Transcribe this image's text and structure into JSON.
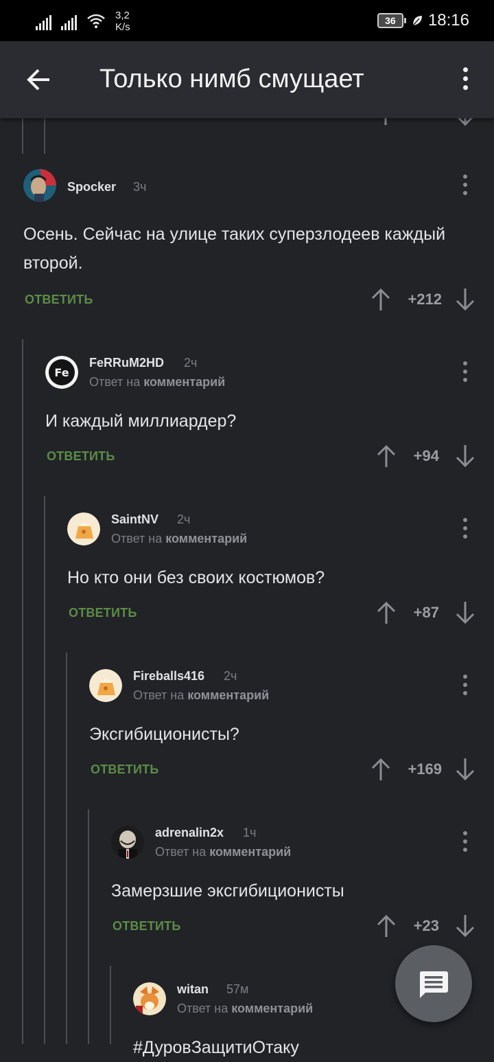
{
  "status_bar": {
    "speed_value": "3,2",
    "speed_unit": "K/s",
    "battery": "36",
    "time": "18:16"
  },
  "app_bar": {
    "title": "Только нимб смущает"
  },
  "comments": [
    {
      "author": "Spocker",
      "time": "3ч",
      "reply_to_prefix": "",
      "reply_to_link": "",
      "text": "Осень. Сейчас на улице таких суперзлодеев каждый второй.",
      "reply_label": "ОТВЕТИТЬ",
      "score": "+212"
    },
    {
      "author": "FeRRuM2HD",
      "time": "2ч",
      "reply_to_prefix": "Ответ на",
      "reply_to_link": "комментарий",
      "text": "И каждый миллиардер?",
      "reply_label": "ОТВЕТИТЬ",
      "score": "+94"
    },
    {
      "author": "SaintNV",
      "time": "2ч",
      "reply_to_prefix": "Ответ на",
      "reply_to_link": "комментарий",
      "text": "Но кто они без своих костюмов?",
      "reply_label": "ОТВЕТИТЬ",
      "score": "+87"
    },
    {
      "author": "Fireballs416",
      "time": "2ч",
      "reply_to_prefix": "Ответ на",
      "reply_to_link": "комментарий",
      "text": "Эксгибиционисты?",
      "reply_label": "ОТВЕТИТЬ",
      "score": "+169"
    },
    {
      "author": "adrenalin2x",
      "time": "1ч",
      "reply_to_prefix": "Ответ на",
      "reply_to_link": "комментарий",
      "text": "Замерзшие эксгибиционисты",
      "reply_label": "ОТВЕТИТЬ",
      "score": "+23"
    },
    {
      "author": "witan",
      "time": "57м",
      "reply_to_prefix": "Ответ на",
      "reply_to_link": "комментарий",
      "text": "#ДуровЗащитиОтаку",
      "reply_label": "",
      "score": ""
    }
  ],
  "icons": {
    "back": "arrow-left-icon",
    "more": "more-vert-icon",
    "upvote": "arrow-up-icon",
    "downvote": "arrow-down-icon",
    "fab": "comment-icon"
  },
  "colors": {
    "background": "#212327",
    "appbar": "#2a2c31",
    "reply_green": "#5c8c47",
    "muted": "#7b7e84"
  }
}
